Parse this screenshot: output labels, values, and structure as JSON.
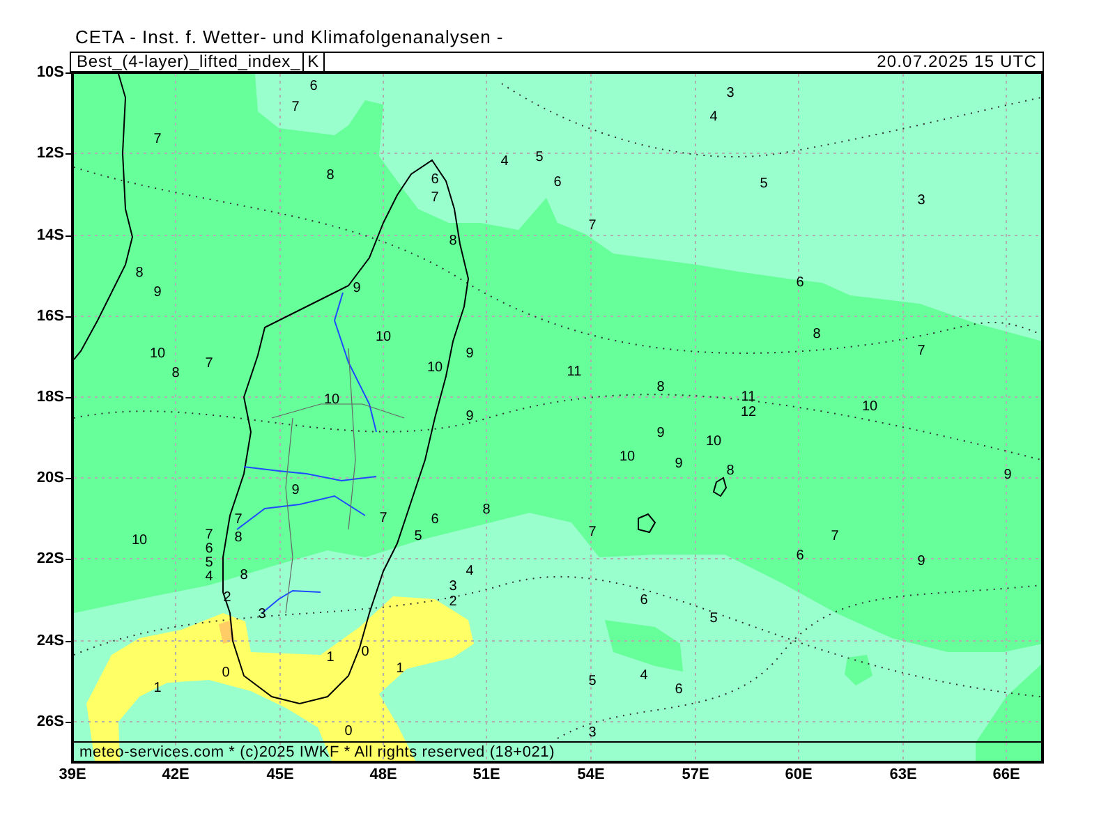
{
  "title": "CETA - Inst. f. Wetter- und Klimafolgenanalysen -",
  "header": {
    "variable": "Best_(4-layer)_lifted_index_",
    "unit": "K",
    "valid_time": "20.07.2025 15 UTC"
  },
  "lat_labels": [
    "10S",
    "12S",
    "14S",
    "16S",
    "18S",
    "20S",
    "22S",
    "24S",
    "26S"
  ],
  "lon_labels": [
    "39E",
    "42E",
    "45E",
    "48E",
    "51E",
    "54E",
    "57E",
    "60E",
    "63E",
    "66E"
  ],
  "contour_labels": [
    "6",
    "3",
    "7",
    "4",
    "7",
    "4",
    "5",
    "8",
    "6",
    "6",
    "5",
    "7",
    "3",
    "7",
    "8",
    "8",
    "9",
    "9",
    "6",
    "10",
    "8",
    "10",
    "8",
    "7",
    "10",
    "9",
    "11",
    "7",
    "10",
    "9",
    "8",
    "11",
    "12",
    "10",
    "9",
    "10",
    "10",
    "9",
    "8",
    "9",
    "9",
    "7",
    "7",
    "6",
    "8",
    "10",
    "7",
    "8",
    "5",
    "7",
    "7",
    "6",
    "5",
    "6",
    "9",
    "4",
    "8",
    "4",
    "2",
    "3",
    "2",
    "6",
    "3",
    "5",
    "1",
    "0",
    "1",
    "0",
    "1",
    "5",
    "4",
    "6",
    "0",
    "3"
  ],
  "footer": "meteo-services.com * (c)2025 IWKF * All rights reserved (18+021)"
}
